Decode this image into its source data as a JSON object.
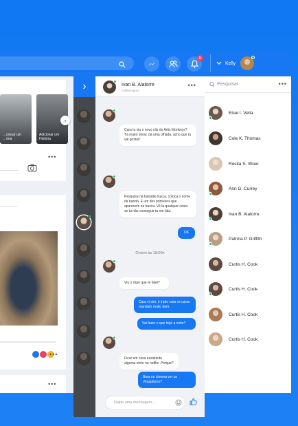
{
  "topbar": {
    "user_name": "Kelly",
    "notif_count": "11"
  },
  "feed": {
    "story1": "…cionar um\n…ória",
    "story2": "Adicionar um\nHistória"
  },
  "chat": {
    "header_name": "Ivan B. Alatorre",
    "header_status": "Online agora",
    "messages": [
      "Cara tu viu o novo clip do Artic Monkeys? Tá muito show, da uma olhada, acho que tu vai gostar!",
      "Pesquisa na barrade busca, coloca o nome da banda. E um dos primeiros que aparecem na busca. Vê lá qualquer coisa se tu não conseguir tu me fala.",
      "OK",
      "Ontem às 18:00h",
      "Viu o clipe que te falei?",
      "Cara vi sim, ó irado cara os caras mandam muito bem.",
      "Vai fazer o que hoje a noite?",
      "Ficar em casa assistindo algoma série na netflix. Porque?",
      "Bora no cinema ver os Vingadores?"
    ],
    "composer_placeholder": "Digite uma mensagem..."
  },
  "contacts": {
    "search_placeholder": "Pesquisar",
    "list": [
      "Elsie I. Vella",
      "Cole K. Thomas",
      "Rosita S. Wren",
      "Ann G. Currey",
      "Ivan B. Alatorre",
      "Patrina P. Griffith",
      "Curtis H. Cook",
      "Curtis H. Cook",
      "Curtis H. Cook",
      "Curtis H. Cook"
    ]
  }
}
